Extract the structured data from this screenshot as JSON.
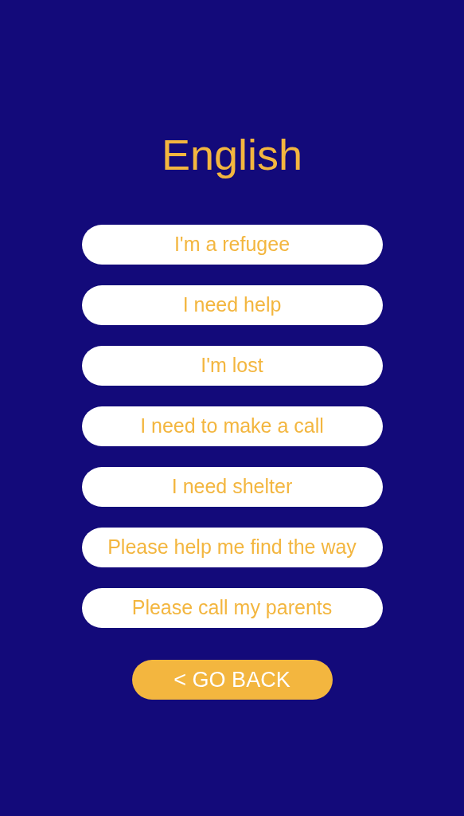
{
  "title": "English",
  "phrases": [
    {
      "label": "I'm a refugee"
    },
    {
      "label": "I need help"
    },
    {
      "label": "I'm lost"
    },
    {
      "label": "I need to make a call"
    },
    {
      "label": "I need shelter"
    },
    {
      "label": "Please help me find the way"
    },
    {
      "label": "Please call my parents"
    }
  ],
  "back_button": {
    "label": "< GO BACK"
  }
}
